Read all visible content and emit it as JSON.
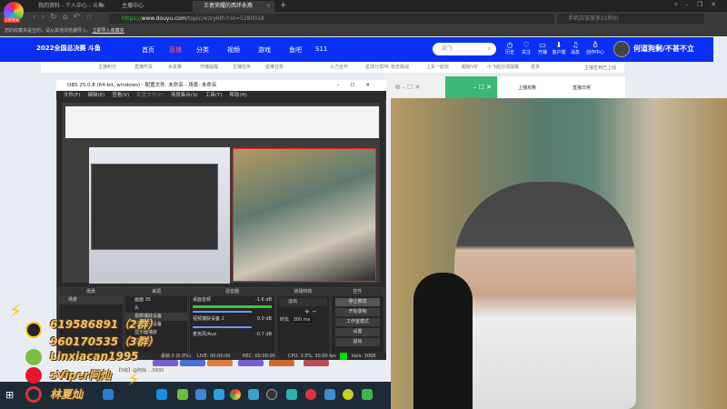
{
  "browser": {
    "badge": "立即登录",
    "tabs": [
      {
        "label": "我的资料 - 个人中心 - 斗鱼"
      },
      {
        "label": "主播中心"
      },
      {
        "label": "王者荣耀的西环永燕",
        "active": true
      }
    ],
    "url_scheme": "https://",
    "url_host": "www.douyu.com",
    "url_path": "/topic/wzry6th?rid=5280018",
    "search_placeholder": "手机应该放多11秒价",
    "bookmark_text": "您的收藏夹是空的，请从其他浏览器导入。",
    "bookmark_link": "立即导入收藏夹"
  },
  "site": {
    "brand": "2022全国总决赛 斗鱼",
    "nav": [
      "首页",
      "直播",
      "分类",
      "视频",
      "游戏",
      "鱼吧",
      "S11"
    ],
    "search_placeholder": "周飞",
    "icons": [
      {
        "label": "历史",
        "icon": "clock"
      },
      {
        "label": "关注",
        "icon": "heart"
      },
      {
        "label": "开播",
        "icon": "video"
      },
      {
        "label": "客户端",
        "icon": "download"
      },
      {
        "label": "消息",
        "icon": "bell"
      },
      {
        "label": "创作中心",
        "icon": "bulb"
      }
    ],
    "username": "何道狗剩/不甚不立",
    "subnav": [
      "主播积分",
      "直播开关",
      "水友赛",
      "开播提醒",
      "主播任务",
      "星推任务",
      "火力全开",
      "星球分享PK",
      "狙击挑战",
      "上车一起玩",
      "超级VIP",
      "小飞船分成提醒",
      "更多"
    ],
    "subnav_note": "主播签到已上线"
  },
  "obs": {
    "title": "OBS 25.0.8 (64-bit, windows) - 配置文件: 未命名 - 场景: 未命名",
    "menu": [
      "文件(F)",
      "编辑(E)",
      "查看(V)",
      "配置文件(P)",
      "场景集合(S)",
      "工具(T)",
      "帮助(H)"
    ],
    "panels": {
      "scenes": {
        "title": "场景",
        "items": [
          "场景"
        ]
      },
      "sources": {
        "title": "来源",
        "items": [
          "画面 35",
          "头",
          "视频捕获设备",
          "视频捕获设备",
          "显示器捕获",
          "窗口捕获"
        ]
      },
      "mixer": {
        "title": "混音器",
        "tracks": [
          {
            "name": "桌面音频",
            "db": "-1.6 dB"
          },
          {
            "name": "视频捕获设备 2",
            "db": "0.0 dB"
          },
          {
            "name": "麦克风/Aux",
            "db": "-0.7 dB"
          }
        ]
      },
      "transitions": {
        "title": "转场特效",
        "type": "淡出",
        "duration_label": "时长",
        "duration": "300 ms"
      },
      "controls": {
        "title": "控件",
        "buttons": [
          "停止推流",
          "开始录制",
          "工作室模式",
          "设置",
          "退出"
        ]
      }
    },
    "status": {
      "dropped": "丢帧 0 (0.0%)",
      "live": "LIVE: 00:00:00",
      "rec": "REC: 00:00:00",
      "cpu": "CPU: 3.5%, 30.00 fps",
      "kbps": "kb/s: 3068"
    },
    "status_color": "#00e000"
  },
  "overlay": [
    {
      "icon": "qq",
      "text": "619586891（2群）"
    },
    {
      "icon": "qq",
      "text": "960170535（3群）"
    },
    {
      "icon": "wechat",
      "text": "Linxiacan1995"
    },
    {
      "icon": "weibo",
      "text": "sViper阿灿"
    },
    {
      "icon": "netease",
      "text": "林夏灿"
    }
  ],
  "right_panel": {
    "links": [
      "上播攻略",
      "直播日常"
    ]
  },
  "chat_input": "【5级】@阿灿 ...0930"
}
